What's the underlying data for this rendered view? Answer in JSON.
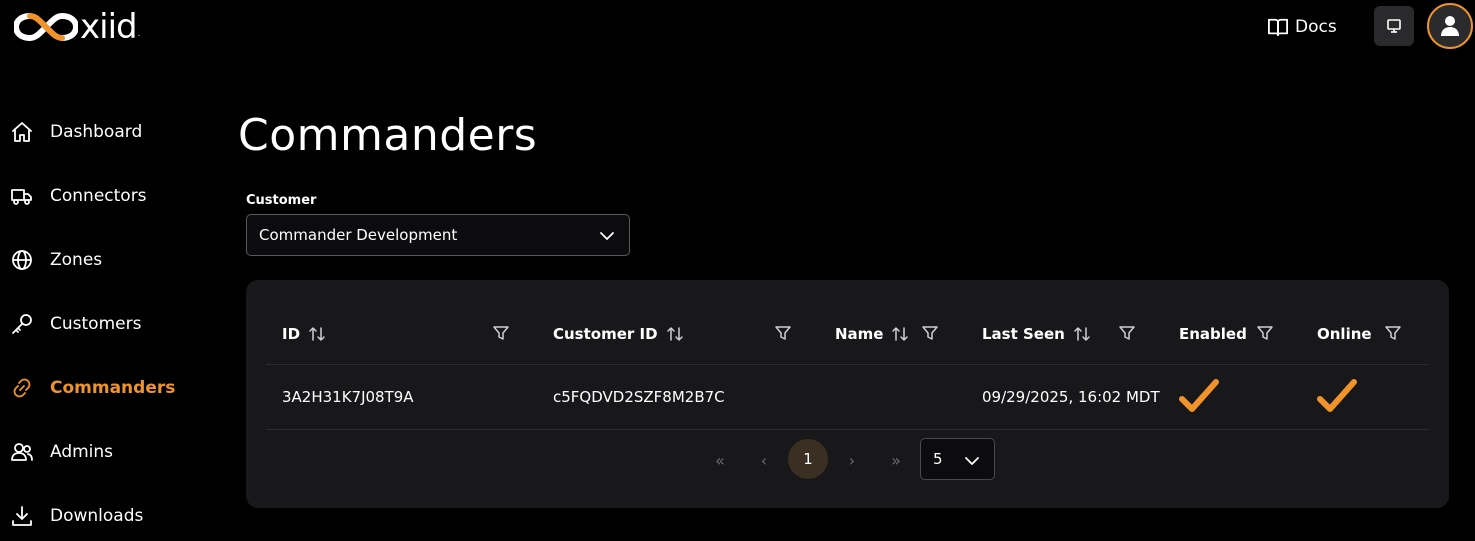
{
  "header": {
    "logo_text": "xiid",
    "logo_mark": ".",
    "docs_label": "Docs",
    "accent": "#f0932b"
  },
  "sidebar": {
    "items": [
      {
        "label": "Dashboard",
        "icon": "home-icon"
      },
      {
        "label": "Connectors",
        "icon": "truck-icon"
      },
      {
        "label": "Zones",
        "icon": "globe-icon"
      },
      {
        "label": "Customers",
        "icon": "key-icon"
      },
      {
        "label": "Commanders",
        "icon": "link-icon",
        "active": true
      },
      {
        "label": "Admins",
        "icon": "users-icon"
      },
      {
        "label": "Downloads",
        "icon": "download-icon"
      }
    ]
  },
  "main": {
    "title": "Commanders",
    "customer": {
      "label": "Customer",
      "selected": "Commander Development"
    },
    "table": {
      "columns": [
        "ID",
        "Customer ID",
        "Name",
        "Last Seen",
        "Enabled",
        "Online"
      ],
      "rows": [
        {
          "id": "3A2H31K7J08T9A",
          "customer_id": "c5FQDVD2SZF8M2B7C",
          "name": "",
          "last_seen": "09/29/2025, 16:02 MDT",
          "enabled": true,
          "online": true
        }
      ]
    },
    "pagination": {
      "first": "«",
      "prev": "‹",
      "current_page": "1",
      "next": "›",
      "last": "»",
      "page_size": "5"
    }
  }
}
